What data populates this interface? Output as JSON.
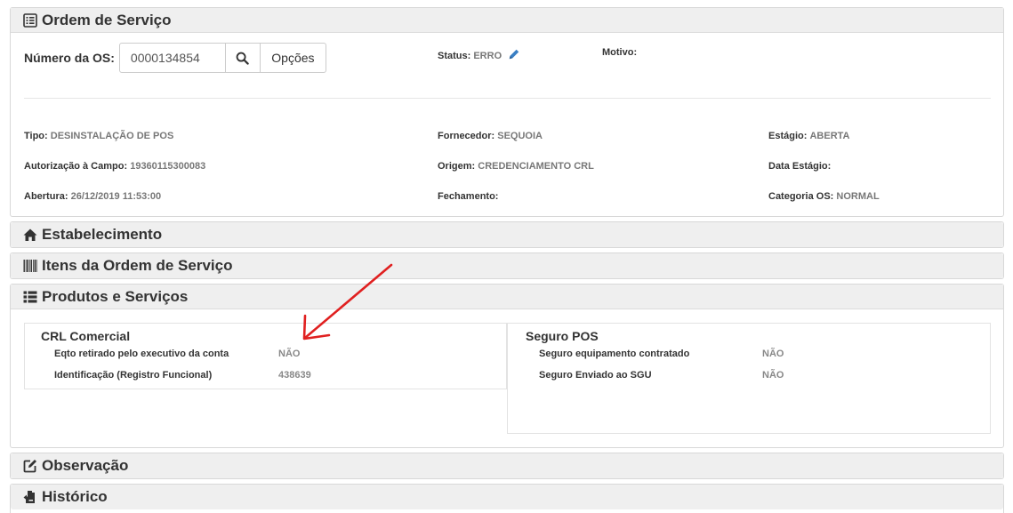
{
  "ordem": {
    "title": "Ordem de Serviço",
    "numero_label": "Número da OS:",
    "numero_value": "0000134854",
    "opcoes_label": "Opções",
    "status_label": "Status:",
    "status_value": "ERRO",
    "motivo_label": "Motivo:",
    "fields": {
      "tipo_label": "Tipo:",
      "tipo_value": "DESINSTALAÇÃO DE POS",
      "autorizacao_label": "Autorização à Campo:",
      "autorizacao_value": "19360115300083",
      "abertura_label": "Abertura:",
      "abertura_value": "26/12/2019 11:53:00",
      "fornecedor_label": "Fornecedor:",
      "fornecedor_value": "SEQUOIA",
      "origem_label": "Origem:",
      "origem_value": "CREDENCIAMENTO CRL",
      "fechamento_label": "Fechamento:",
      "fechamento_value": "",
      "estagio_label": "Estágio:",
      "estagio_value": "ABERTA",
      "data_estagio_label": "Data Estágio:",
      "data_estagio_value": "",
      "categoria_label": "Categoria OS:",
      "categoria_value": "NORMAL"
    }
  },
  "estabelecimento": {
    "title": "Estabelecimento"
  },
  "itens": {
    "title": "Itens da Ordem de Serviço"
  },
  "produtos": {
    "title": "Produtos e Serviços",
    "crl": {
      "title": "CRL Comercial",
      "rows": [
        {
          "label": "Eqto retirado pelo executivo da conta",
          "value": "NÃO"
        },
        {
          "label": "Identificação (Registro Funcional)",
          "value": "438639"
        }
      ]
    },
    "seguro": {
      "title": "Seguro POS",
      "rows": [
        {
          "label": "Seguro equipamento contratado",
          "value": "NÃO"
        },
        {
          "label": "Seguro Enviado ao SGU",
          "value": "NÃO"
        }
      ]
    }
  },
  "observacao": {
    "title": "Observação"
  },
  "historico": {
    "title": "Histórico"
  },
  "colors": {
    "annotation_arrow": "#e02020",
    "edit_icon": "#3a7fc4"
  }
}
